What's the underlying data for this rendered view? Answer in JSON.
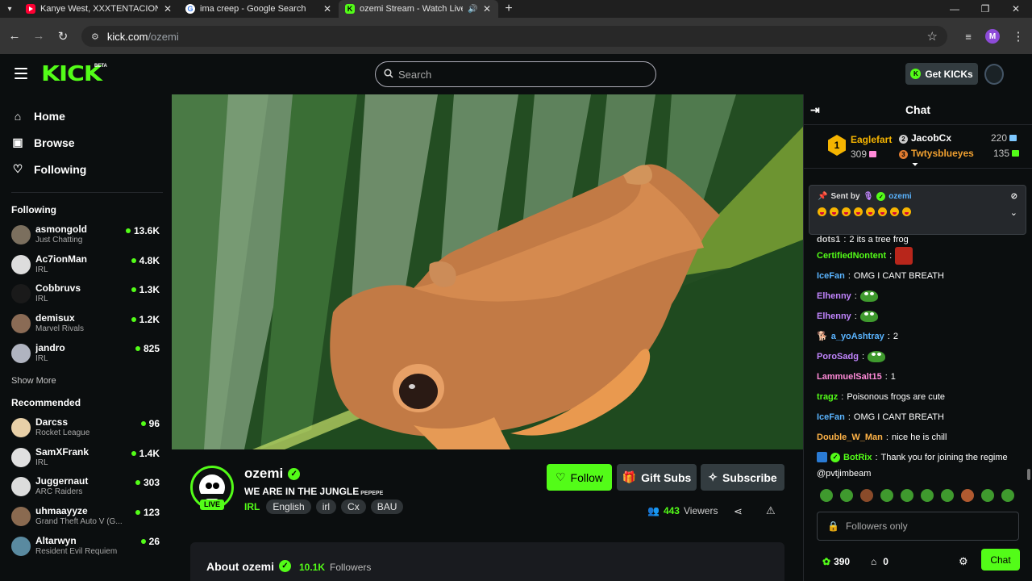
{
  "browser": {
    "tabs": [
      {
        "title": "Kanye West, XXXTENTACION - T",
        "favicon": "youtube-icon"
      },
      {
        "title": "ima creep - Google Search",
        "favicon": "google-icon"
      },
      {
        "title": "ozemi Stream - Watch Live",
        "favicon": "kick-icon"
      }
    ],
    "url_domain": "kick.com",
    "url_path": "/ozemi",
    "profile_initial": "M"
  },
  "header": {
    "logo": "KICK",
    "beta": "BETA",
    "search_placeholder": "Search",
    "get_kicks": "Get KICKs"
  },
  "sidebar": {
    "nav": [
      {
        "label": "Home",
        "icon": "home-icon"
      },
      {
        "label": "Browse",
        "icon": "browse-icon"
      },
      {
        "label": "Following",
        "icon": "heart-icon"
      }
    ],
    "following_title": "Following",
    "following": [
      {
        "name": "asmongold",
        "category": "Just Chatting",
        "viewers": "13.6K",
        "color": "#7b6f5e"
      },
      {
        "name": "Ac7ionMan",
        "category": "IRL",
        "viewers": "4.8K",
        "color": "#ddd"
      },
      {
        "name": "Cobbruvs",
        "category": "IRL",
        "viewers": "1.3K",
        "color": "#1a1a1a"
      },
      {
        "name": "demisux",
        "category": "Marvel Rivals",
        "viewers": "1.2K",
        "color": "#8a6b55"
      },
      {
        "name": "jandro",
        "category": "IRL",
        "viewers": "825",
        "color": "#b0b4c0"
      }
    ],
    "show_more": "Show More",
    "recommended_title": "Recommended",
    "recommended": [
      {
        "name": "Darcss",
        "category": "Rocket League",
        "viewers": "96",
        "color": "#e8d0a8"
      },
      {
        "name": "SamXFrank",
        "category": "IRL",
        "viewers": "1.4K",
        "color": "#e0e0e0"
      },
      {
        "name": "Juggernaut",
        "category": "ARC Raiders",
        "viewers": "303",
        "color": "#dcdcdc"
      },
      {
        "name": "uhmaayyze",
        "category": "Grand Theft Auto V (G...",
        "viewers": "123",
        "color": "#8a6a50"
      },
      {
        "name": "Altarwyn",
        "category": "Resident Evil Requiem",
        "viewers": "26",
        "color": "#5a8aa0"
      }
    ]
  },
  "stream": {
    "channel": "ozemi",
    "live": "LIVE",
    "title": "WE ARE IN THE JUNGLE",
    "title_emote": "PEPEPE",
    "category": "IRL",
    "tags": [
      "English",
      "irl",
      "Cx",
      "BAU"
    ],
    "follow": "Follow",
    "gift_subs": "Gift Subs",
    "subscribe": "Subscribe",
    "viewers_count": "443",
    "viewers_label": "Viewers",
    "about_title": "About ozemi",
    "followers_count": "10.1K",
    "followers_label": "Followers"
  },
  "chat": {
    "title": "Chat",
    "leaderboard": {
      "first": {
        "name": "Eaglefart",
        "value": "309",
        "rank": "1"
      },
      "second": {
        "name": "JacobCx",
        "value": "220",
        "rank": "2"
      },
      "third": {
        "name": "Twtysblueyes",
        "value": "135",
        "rank": "3"
      }
    },
    "pinned": {
      "sent_by": "Sent by",
      "user": "ozemi"
    },
    "messages": [
      {
        "user": "dots1",
        "text": "2 its a tree frog",
        "color": "#cfcfcf",
        "emote": ""
      },
      {
        "user": "CertifiedNontent",
        "text": "",
        "color": "#53fc18",
        "emote": "face"
      },
      {
        "user": "IceFan",
        "text": "OMG I CANT BREATH",
        "color": "#5ab4ff",
        "emote": ""
      },
      {
        "user": "Elhenny",
        "text": "",
        "color": "#c084fc",
        "emote": "pepe"
      },
      {
        "user": "Elhenny",
        "text": "",
        "color": "#c084fc",
        "emote": "pepe"
      },
      {
        "user": "a_yoAshtray",
        "text": "2",
        "color": "#5ab4ff",
        "emote": ""
      },
      {
        "user": "PoroSadg",
        "text": "",
        "color": "#c084fc",
        "emote": "pepe"
      },
      {
        "user": "LammuelSalt15",
        "text": "1",
        "color": "#ff8ad8",
        "emote": ""
      },
      {
        "user": "tragz",
        "text": "Poisonous frogs are cute",
        "color": "#53fc18",
        "emote": ""
      },
      {
        "user": "IceFan",
        "text": "OMG I CANT BREATH",
        "color": "#5ab4ff",
        "emote": ""
      },
      {
        "user": "Double_W_Man",
        "text": "nice he is chill",
        "color": "#ffb347",
        "emote": ""
      },
      {
        "user": "BotRix",
        "text": "Thank you for joining the regime",
        "color": "#53fc18",
        "emote": ""
      }
    ],
    "botrix_mention": "@pvtjimbeam",
    "input_placeholder": "Followers only",
    "kicks": "390",
    "redeem": "0",
    "chat_button": "Chat"
  }
}
